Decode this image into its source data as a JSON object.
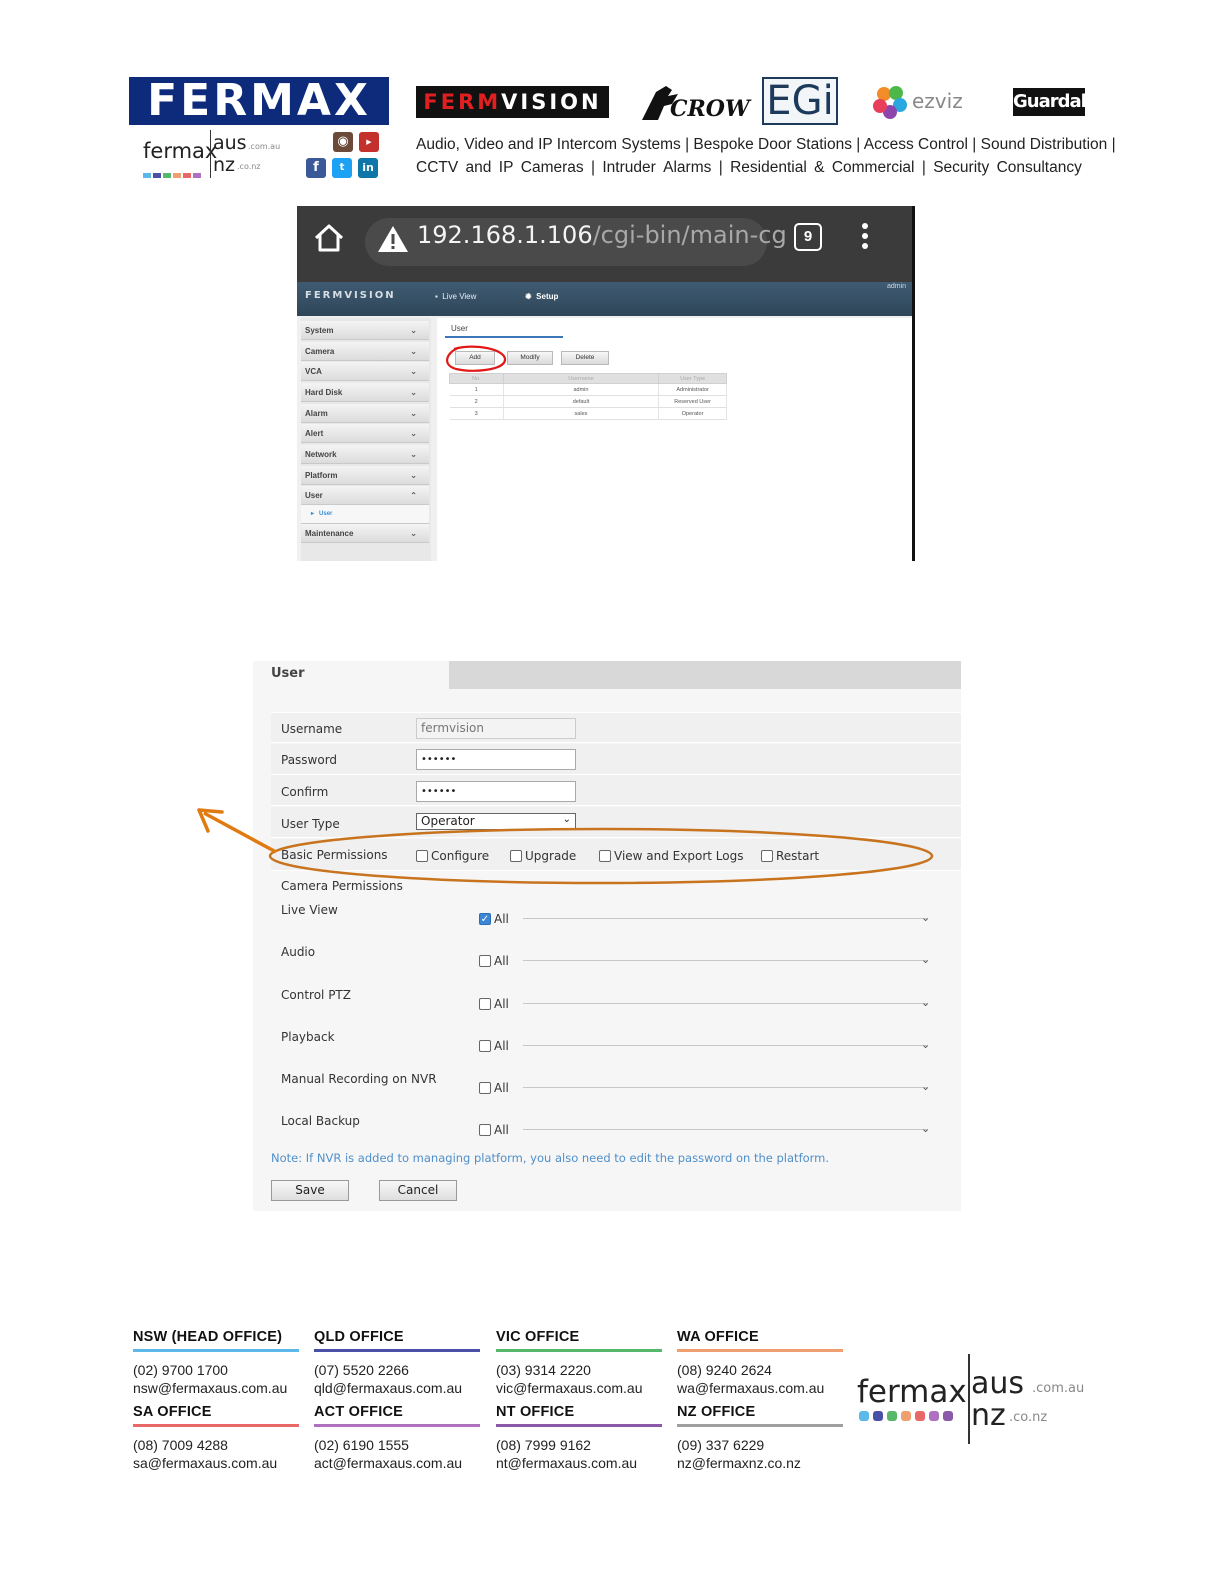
{
  "header": {
    "fermax_logo": "FERMAX",
    "fermax_aus": {
      "word": "fermax",
      "aus": "aus",
      "aus_suffix": ".com.au",
      "nz": "nz",
      "nz_suffix": ".co.nz"
    },
    "fermvision_logo": {
      "a": "FERM",
      "b": "VISION"
    },
    "crow_logo": "CROW",
    "egi_logo": "EGi",
    "ezviz_logo": "ezviz",
    "guardall_logo": "Guardall",
    "social_icons": [
      "instagram-icon",
      "youtube-icon",
      "facebook-icon",
      "twitter-icon",
      "linkedin-icon"
    ],
    "tagline_line1": "Audio, Video and IP Intercom Systems | Bespoke Door Stations | Access Control | Sound Distribution |",
    "tagline_line2": [
      "CCTV",
      "and",
      "IP",
      "Cameras",
      "|",
      "Intruder",
      "Alarms",
      "|",
      "Residential",
      "&",
      "Commercial",
      "|",
      "Security",
      "Consultancy"
    ]
  },
  "screenshot1": {
    "url_host": "192.168.1.106",
    "url_path": "/cgi-bin/main-cg",
    "tab_count": "9",
    "nvr_logo": "FERMVISION",
    "nav_live_view": "Live View",
    "nav_setup": "Setup",
    "admin_label": "admin",
    "sidebar": [
      "System",
      "Camera",
      "VCA",
      "Hard Disk",
      "Alarm",
      "Alert",
      "Network",
      "Platform",
      "User",
      "Maintenance"
    ],
    "sidebar_sub": "User",
    "panel_tab": "User",
    "buttons": {
      "add": "Add",
      "modify": "Modify",
      "delete": "Delete"
    },
    "table_headers": [
      "No.",
      "Username",
      "User Type"
    ],
    "table_rows": [
      [
        "1",
        "admin",
        "Administrator"
      ],
      [
        "2",
        "default",
        "Reserved User"
      ],
      [
        "3",
        "sales",
        "Operator"
      ]
    ],
    "colors": {
      "browser_bar": "#3b3b3b",
      "nvr_bar": "#34506a",
      "annotation": "#e01818"
    }
  },
  "form": {
    "tab": "User",
    "username_label": "Username",
    "username_value": "fermvision",
    "password_label": "Password",
    "password_value": "••••••",
    "confirm_label": "Confirm",
    "confirm_value": "••••••",
    "usertype_label": "User Type",
    "usertype_value": "Operator",
    "basic_label": "Basic Permissions",
    "basic_options": [
      {
        "label": "Configure",
        "checked": false
      },
      {
        "label": "Upgrade",
        "checked": false
      },
      {
        "label": "View and Export Logs",
        "checked": false
      },
      {
        "label": "Restart",
        "checked": false
      }
    ],
    "camera_label": "Camera Permissions",
    "camera_perms": [
      {
        "label": "Live View",
        "option": "All",
        "checked": true
      },
      {
        "label": "Audio",
        "option": "All",
        "checked": false
      },
      {
        "label": "Control PTZ",
        "option": "All",
        "checked": false
      },
      {
        "label": "Playback",
        "option": "All",
        "checked": false
      },
      {
        "label": "Manual Recording on NVR",
        "option": "All",
        "checked": false
      },
      {
        "label": "Local Backup",
        "option": "All",
        "checked": false
      }
    ],
    "note": "Note: If NVR is added to managing platform, you also need to edit the password on the platform.",
    "save": "Save",
    "cancel": "Cancel",
    "colors": {
      "annotation": "#c8741e",
      "checkbox_checked": "#3d86d6",
      "note": "#4f8fca"
    }
  },
  "footer": {
    "offices": [
      {
        "name": "NSW (HEAD OFFICE)",
        "phone": "(02) 9700 1700",
        "email": "nsw@fermaxaus.com.au",
        "color": "#5bb8e8"
      },
      {
        "name": "QLD OFFICE",
        "phone": "(07) 5520 2266",
        "email": "qld@fermaxaus.com.au",
        "color": "#4a4fa8"
      },
      {
        "name": "VIC OFFICE",
        "phone": "(03) 9314 2220",
        "email": "vic@fermaxaus.com.au",
        "color": "#55b86a"
      },
      {
        "name": "WA OFFICE",
        "phone": "(08) 9240 2624",
        "email": "wa@fermaxaus.com.au",
        "color": "#f0a070"
      },
      {
        "name": "SA OFFICE",
        "phone": "(08) 7009 4288",
        "email": "sa@fermaxaus.com.au",
        "color": "#e86868"
      },
      {
        "name": "ACT OFFICE",
        "phone": "(02) 6190 1555",
        "email": "act@fermaxaus.com.au",
        "color": "#b070c0"
      },
      {
        "name": "NT OFFICE",
        "phone": "(08) 7999 9162",
        "email": "nt@fermaxaus.com.au",
        "color": "#8a5aa8"
      },
      {
        "name": "NZ OFFICE",
        "phone": "(09) 337 6229",
        "email": "nz@fermaxnz.co.nz",
        "color": "#a0a0a0"
      }
    ],
    "logo": {
      "word": "fermax",
      "aus": "aus",
      "aus_suffix": ".com.au",
      "nz": "nz",
      "nz_suffix": ".co.nz"
    }
  }
}
